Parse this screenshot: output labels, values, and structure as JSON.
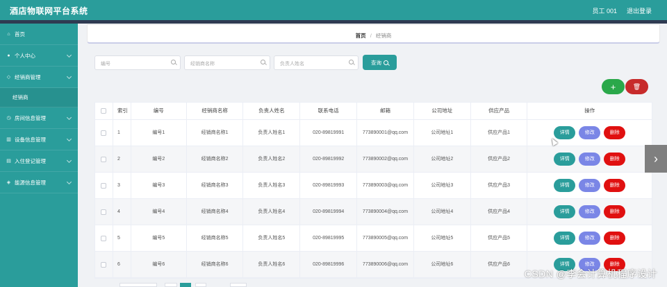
{
  "app": {
    "title": "酒店物联网平台系统",
    "user": "员工 001",
    "logout": "退出登录"
  },
  "sidebar": {
    "items": [
      {
        "label": "首页",
        "icon": "home-icon"
      },
      {
        "label": "个人中心",
        "icon": "person-icon"
      },
      {
        "label": "经销商管理",
        "icon": "tag-icon"
      },
      {
        "label": "经销商",
        "sub": true
      },
      {
        "label": "房间信息管理",
        "icon": "clock-icon"
      },
      {
        "label": "设备信息管理",
        "icon": "chart-icon"
      },
      {
        "label": "入住登记管理",
        "icon": "doc-icon"
      },
      {
        "label": "能源信息管理",
        "icon": "shield-icon"
      }
    ]
  },
  "breadcrumb": {
    "home": "首页",
    "current": "经销商"
  },
  "search": {
    "code_placeholder": "编号",
    "name_placeholder": "经销商名称",
    "person_placeholder": "负责人姓名",
    "button": "查询"
  },
  "toolbar": {
    "add": "+",
    "delete": "🗑"
  },
  "table": {
    "headers": [
      "索引",
      "编号",
      "经销商名称",
      "负责人姓名",
      "联系电话",
      "邮箱",
      "公司地址",
      "供应产品",
      "操作"
    ],
    "rows": [
      {
        "idx": "1",
        "code": "编号1",
        "name": "经销商名称1",
        "person": "负责人姓名1",
        "phone": "020-89819991",
        "email": "773890001@qq.com",
        "addr": "公司地址1",
        "prod": "供应产品1"
      },
      {
        "idx": "2",
        "code": "编号2",
        "name": "经销商名称2",
        "person": "负责人姓名2",
        "phone": "020-89819992",
        "email": "773890002@qq.com",
        "addr": "公司地址2",
        "prod": "供应产品2"
      },
      {
        "idx": "3",
        "code": "编号3",
        "name": "经销商名称3",
        "person": "负责人姓名3",
        "phone": "020-89819993",
        "email": "773890003@qq.com",
        "addr": "公司地址3",
        "prod": "供应产品3"
      },
      {
        "idx": "4",
        "code": "编号4",
        "name": "经销商名称4",
        "person": "负责人姓名4",
        "phone": "020-89819994",
        "email": "773890004@qq.com",
        "addr": "公司地址4",
        "prod": "供应产品4"
      },
      {
        "idx": "5",
        "code": "编号5",
        "name": "经销商名称5",
        "person": "负责人姓名5",
        "phone": "020-89819995",
        "email": "773890005@qq.com",
        "addr": "公司地址5",
        "prod": "供应产品5"
      },
      {
        "idx": "6",
        "code": "编号6",
        "name": "经销商名称6",
        "person": "负责人姓名6",
        "phone": "020-89819996",
        "email": "773890006@qq.com",
        "addr": "公司地址6",
        "prod": "供应产品6"
      }
    ],
    "ops": {
      "detail": "详情",
      "edit": "修改",
      "remove": "删除"
    }
  },
  "watermark": "CSDN @李会计算机程序设计",
  "colors": {
    "primary": "#2a9d9b",
    "edit": "#7a86e6",
    "danger": "#e01010",
    "add": "#2aa84a"
  }
}
